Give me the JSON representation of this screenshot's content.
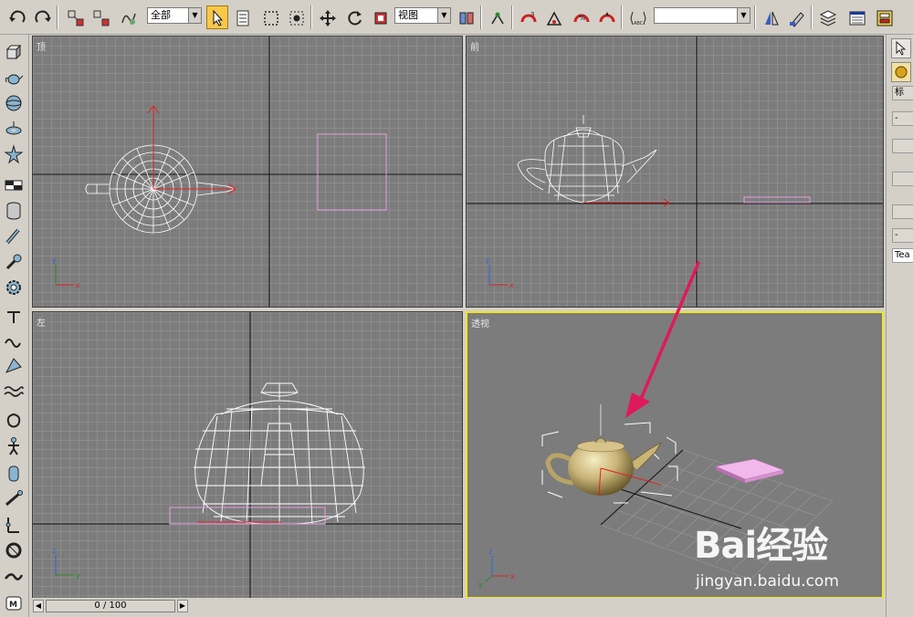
{
  "toolbar": {
    "selection_filter": "全部",
    "reference_coord": "视图",
    "named_selection": ""
  },
  "viewports": {
    "top": "顶",
    "front": "前",
    "left": "左",
    "perspective": "透视"
  },
  "axes": {
    "x": "x",
    "y": "y",
    "z": "z"
  },
  "right_panel": {
    "tab_label": "标",
    "name_field": "Tea"
  },
  "time_slider": {
    "frame_display": "0 / 100"
  },
  "watermark": {
    "brand": "Bai经验",
    "url": "jingyan.baidu.com"
  },
  "colors": {
    "viewport_bg": "#7c7c7c",
    "grid": "#8c8c8c",
    "active_viewport_border": "#f2e51e",
    "wireframe": "#ffffff",
    "box_object": "#e79be0",
    "arrow": "#e0195a",
    "teapot_shaded": "#c9b478"
  }
}
